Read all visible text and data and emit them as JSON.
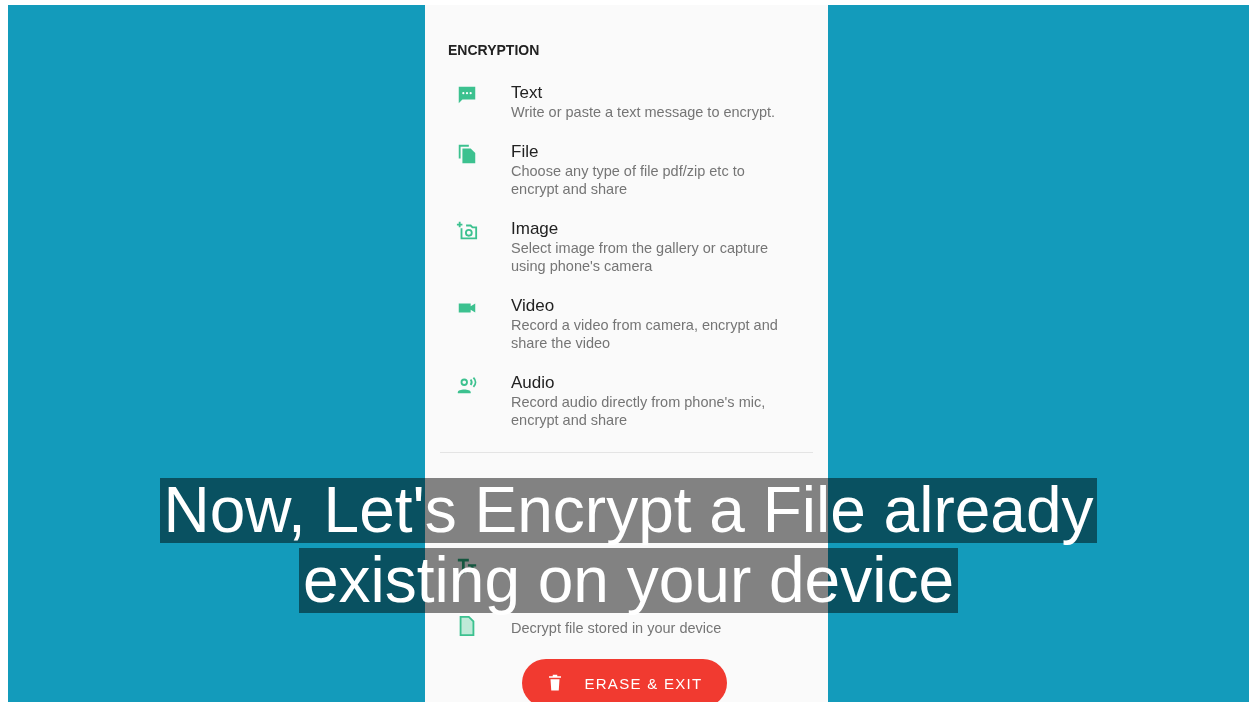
{
  "encryption": {
    "heading": "ENCRYPTION",
    "items": [
      {
        "kind": "text",
        "title": "Text",
        "description": "Write or paste a text message to encrypt."
      },
      {
        "kind": "file",
        "title": "File",
        "description": "Choose any type of file pdf/zip etc to encrypt and share"
      },
      {
        "kind": "image",
        "title": "Image",
        "description": "Select image from the gallery or capture using phone's camera"
      },
      {
        "kind": "video",
        "title": "Video",
        "description": "Record a video from camera, encrypt and share the video"
      },
      {
        "kind": "audio",
        "title": "Audio",
        "description": "Record audio directly from phone's mic, encrypt and share"
      }
    ]
  },
  "decryption": {
    "items": [
      {
        "kind": "text"
      },
      {
        "kind": "file",
        "description": "Decrypt file stored in your device"
      }
    ]
  },
  "erase_button": {
    "label": "ERASE & EXIT"
  },
  "caption": {
    "lines": [
      "Now, Let's Encrypt a File already",
      "existing on your device"
    ]
  }
}
